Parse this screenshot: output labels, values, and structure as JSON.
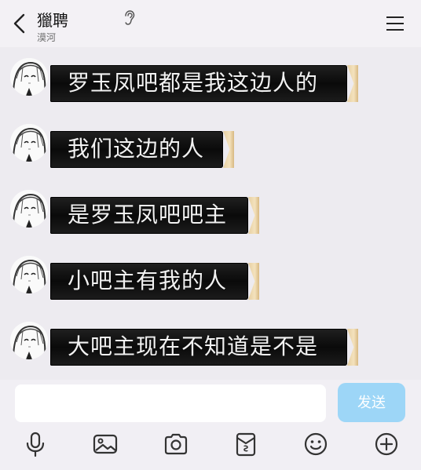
{
  "header": {
    "title": "獵聘",
    "subtitle": "漠河"
  },
  "messages": [
    {
      "text": "罗玉凤吧都是我这边人的"
    },
    {
      "text": "我们这边的人"
    },
    {
      "text": "是罗玉凤吧吧主"
    },
    {
      "text": "小吧主有我的人"
    },
    {
      "text": "大吧主现在不知道是不是"
    }
  ],
  "composer": {
    "input_value": "",
    "send_label": "发送"
  },
  "toolbar": {
    "icons": [
      "microphone-icon",
      "image-icon",
      "camera-icon",
      "red-packet-icon",
      "emoji-icon",
      "plus-icon"
    ]
  },
  "colors": {
    "send_button": "#9dd6f7",
    "bubble_bg": "#111111",
    "bubble_trim": "#efdcb4",
    "background": "#edebf0"
  }
}
